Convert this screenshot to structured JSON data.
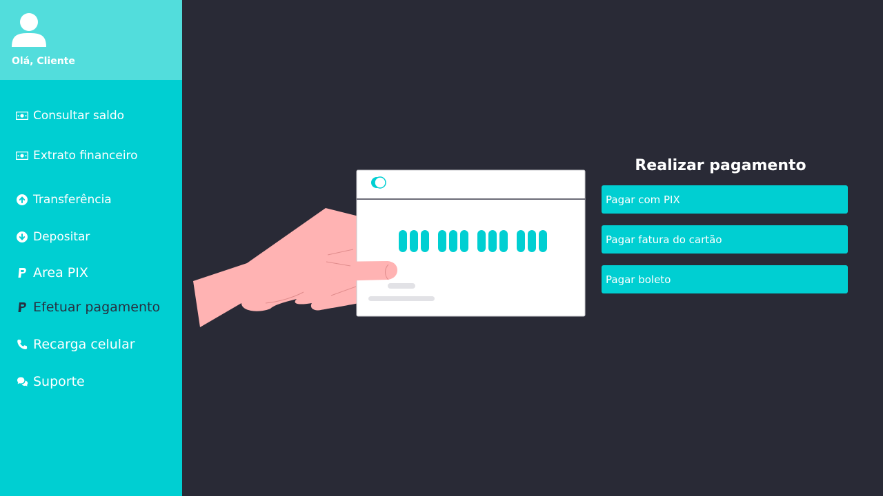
{
  "profile": {
    "greeting": "Olá, Cliente",
    "avatar_icon": "user-icon"
  },
  "sidebar": {
    "items": [
      {
        "label": "Consultar saldo",
        "icon": "money-icon",
        "active": false
      },
      {
        "label": "Extrato financeiro",
        "icon": "money-icon",
        "active": false
      },
      {
        "label": "Transferência",
        "icon": "arrow-up-circle-icon",
        "active": false
      },
      {
        "label": "Depositar",
        "icon": "arrow-down-circle-icon",
        "active": false
      },
      {
        "label": "Area PIX",
        "icon": "paypal-icon",
        "active": false
      },
      {
        "label": "Efetuar pagamento",
        "icon": "paypal-icon",
        "active": true
      },
      {
        "label": "Recarga celular",
        "icon": "phone-icon",
        "active": false
      },
      {
        "label": "Suporte",
        "icon": "chat-icon",
        "active": false
      }
    ]
  },
  "payment": {
    "title": "Realizar pagamento",
    "options": [
      "Pagar com PIX",
      "Pagar fatura do cartão",
      "Pagar boleto"
    ]
  },
  "colors": {
    "background": "#292a36",
    "sidebar": "#00cfd2",
    "profile_header": "#52dddc",
    "active_text": "#283040",
    "accent": "#00cfd2",
    "hand": "#ffb3b3"
  }
}
